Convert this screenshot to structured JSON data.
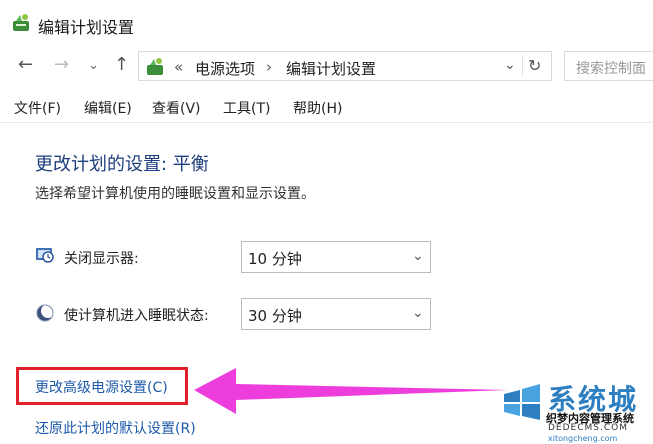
{
  "window": {
    "title": "编辑计划设置"
  },
  "nav": {
    "back_icon": "arrow-left-icon",
    "forward_icon": "arrow-right-icon",
    "recent_icon": "chevron-down-icon",
    "up_icon": "arrow-up-icon",
    "address": {
      "chevron": "«",
      "crumbs": [
        "电源选项",
        "编辑计划设置"
      ],
      "separator": "›",
      "dropdown": "⌄",
      "refresh": "↻"
    },
    "search": {
      "placeholder": "搜索控制面"
    }
  },
  "menu": [
    "文件(F)",
    "编辑(E)",
    "查看(V)",
    "工具(T)",
    "帮助(H)"
  ],
  "main": {
    "title": "更改计划的设置: 平衡",
    "description": "选择希望计算机使用的睡眠设置和显示设置。",
    "settings": [
      {
        "label": "关闭显示器:",
        "value": "10 分钟",
        "icon": "display-clock-icon"
      },
      {
        "label": "使计算机进入睡眠状态:",
        "value": "30 分钟",
        "icon": "sleep-moon-icon"
      }
    ],
    "links": {
      "advanced": "更改高级电源设置(C)",
      "restore": "还原此计划的默认设置(R)"
    }
  },
  "watermark": {
    "brand": "系统城",
    "line1": "织梦内容管理系统",
    "line2": "DEDECMS.COM",
    "line3": "xitongcheng.com"
  },
  "colors": {
    "title_blue": "#1e3e7d",
    "link_blue": "#1e5aa8",
    "highlight_red": "#e0202a",
    "arrow_magenta": "#ee3ddd"
  }
}
